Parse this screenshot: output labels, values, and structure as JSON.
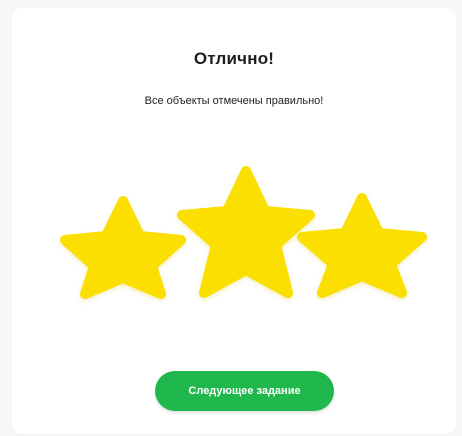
{
  "result": {
    "title": "Отлично!",
    "subtitle": "Все объекты отмечены правильно!",
    "stars": {
      "earned": 3,
      "total": 3,
      "color": "#fadf00"
    }
  },
  "next_button": {
    "label": "Следующее задание",
    "color": "#20b84d"
  },
  "icons": {
    "star": "star-icon"
  }
}
